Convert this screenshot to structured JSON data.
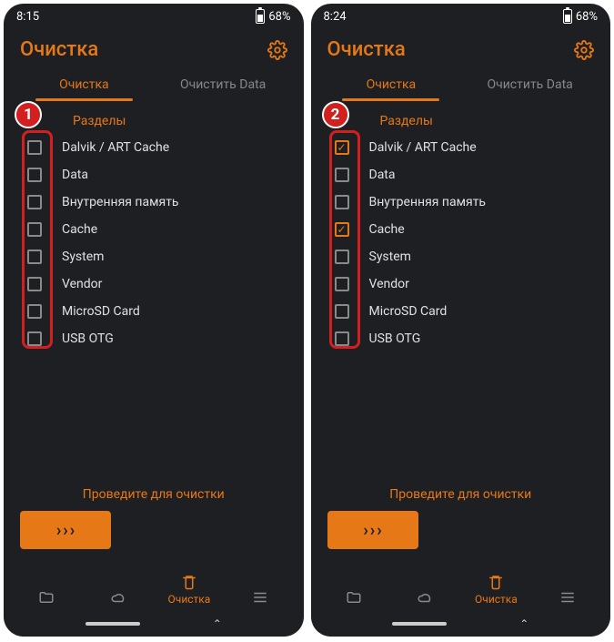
{
  "screens": [
    {
      "time": "8:15",
      "battery": "68%",
      "badge": "1",
      "title": "Очистка",
      "tabs": {
        "active": "Очистка",
        "inactive": "Очистить Data"
      },
      "section": "Разделы",
      "items": [
        {
          "label": "Dalvik / ART Cache",
          "checked": false
        },
        {
          "label": "Data",
          "checked": false
        },
        {
          "label": "Внутренняя память",
          "checked": false
        },
        {
          "label": "Cache",
          "checked": false
        },
        {
          "label": "System",
          "checked": false
        },
        {
          "label": "Vendor",
          "checked": false
        },
        {
          "label": "MicroSD Card",
          "checked": false
        },
        {
          "label": "USB OTG",
          "checked": false
        }
      ],
      "swipe_label": "Проведите для очистки",
      "nav_active": "Очистка"
    },
    {
      "time": "8:24",
      "battery": "68%",
      "badge": "2",
      "title": "Очистка",
      "tabs": {
        "active": "Очистка",
        "inactive": "Очистить Data"
      },
      "section": "Разделы",
      "items": [
        {
          "label": "Dalvik / ART Cache",
          "checked": true
        },
        {
          "label": "Data",
          "checked": false
        },
        {
          "label": "Внутренняя память",
          "checked": false
        },
        {
          "label": "Cache",
          "checked": true
        },
        {
          "label": "System",
          "checked": false
        },
        {
          "label": "Vendor",
          "checked": false
        },
        {
          "label": "MicroSD Card",
          "checked": false
        },
        {
          "label": "USB OTG",
          "checked": false
        }
      ],
      "swipe_label": "Проведите для очистки",
      "nav_active": "Очистка"
    }
  ]
}
